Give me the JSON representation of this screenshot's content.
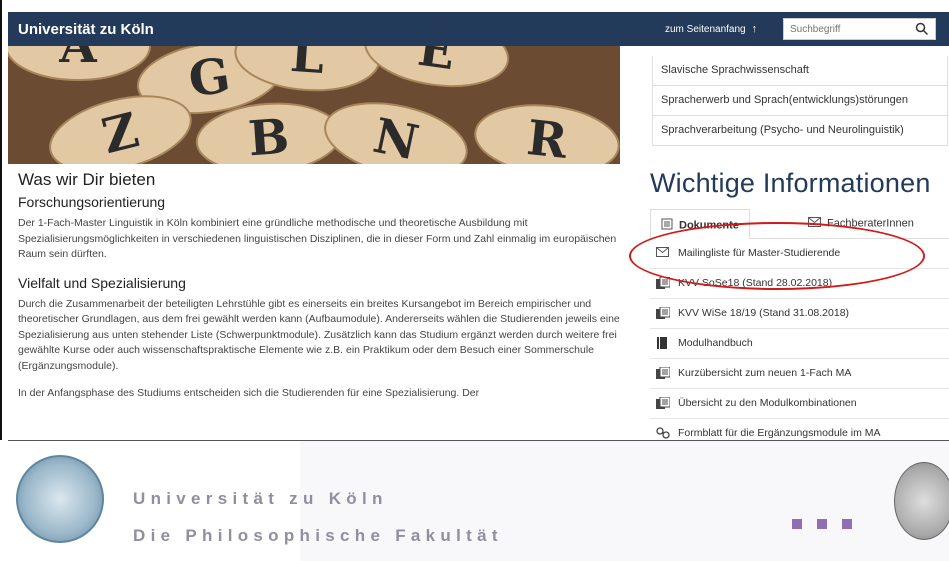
{
  "topbar": {
    "brand": "Universität zu Köln",
    "to_top": "zum Seitenanfang",
    "search_placeholder": "Suchbegriff"
  },
  "hero": {
    "letters": [
      "A",
      "G",
      "L",
      "E",
      "Z",
      "B",
      "N",
      "R"
    ]
  },
  "right_list": [
    "Slavische Sprachwissenschaft",
    "Spracherwerb und Sprach(entwicklungs)störungen",
    "Sprachverarbeitung (Psycho- und Neurolinguistik)"
  ],
  "main": {
    "section_title": "Was wir Dir bieten",
    "sub1": "Forschungsorientierung",
    "para1": "Der 1-Fach-Master Linguistik in Köln kombiniert eine gründliche methodische und theoretische Ausbildung mit Spezialisierungsmöglichkeiten in verschiedenen linguistischen Disziplinen, die in dieser Form und Zahl einmalig im europäischen Raum sein dürften.",
    "sub2": "Vielfalt und Spezialisierung",
    "para2": "Durch die Zusammenarbeit der beteiligten Lehrstühle gibt es einerseits ein breites Kursangebot im Bereich empirischer und theoretischer Grundlagen, aus dem frei gewählt werden kann (Aufbaumodule). Andererseits wählen die Studierenden jeweils eine Spezialisierung aus unten stehender Liste (Schwerpunktmodule). Zusätzlich kann das Studium ergänzt werden durch weitere frei gewählte Kurse oder auch wissenschaftspraktische Elemente wie z.B. ein Praktikum oder dem Besuch einer Sommerschule (Ergänzungsmodule).",
    "para3": "In der Anfangsphase des Studiums entscheiden sich die Studierenden für eine Spezialisierung. Der"
  },
  "info": {
    "title": "Wichtige Informationen",
    "tab_documents": "Dokumente",
    "tab_advisors": "FachberaterInnen",
    "docs": [
      {
        "label": "Mailingliste für Master-Studierende",
        "icon": "mail-icon"
      },
      {
        "label": "KVV SoSe18 (Stand 28.02.2018)",
        "icon": "document-icon"
      },
      {
        "label": "KVV WiSe 18/19 (Stand 31.08.2018)",
        "icon": "document-icon"
      },
      {
        "label": "Modulhandbuch",
        "icon": "book-icon"
      },
      {
        "label": "Kurzübersicht zum neuen 1-Fach MA",
        "icon": "document-icon"
      },
      {
        "label": "Übersicht zu den Modulkombinationen",
        "icon": "document-icon"
      },
      {
        "label": "Formblatt für die Ergänzungsmodule im MA",
        "icon": "link-icon"
      }
    ]
  },
  "footer": {
    "line1": "Universität zu Köln",
    "line2": "Die Philosophische Fakultät"
  },
  "colors": {
    "topbar": "#233a5a",
    "annotation": "#d11a1a",
    "footer_text": "#8f8f9e",
    "accent_squares": "#8f6fb2"
  }
}
